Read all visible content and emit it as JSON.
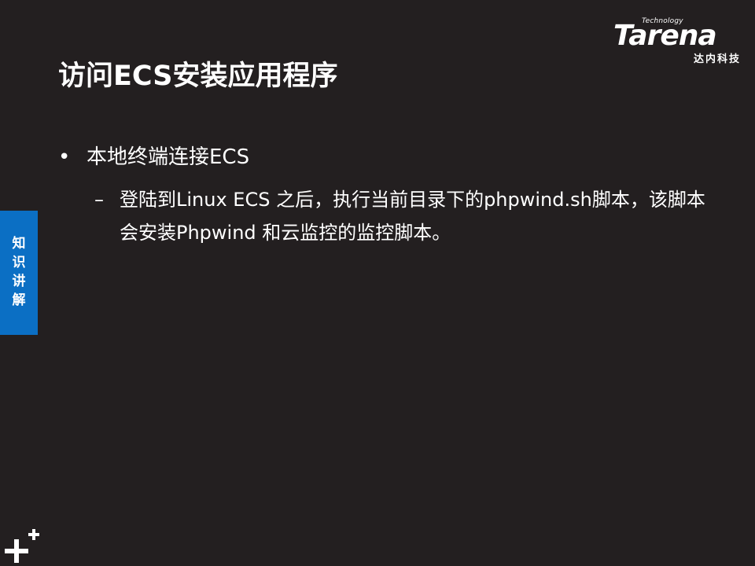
{
  "slide": {
    "title": "访问ECS安装应用程序",
    "logo": {
      "technology": "Technology",
      "brand": "Tarena",
      "cn": "达内科技"
    },
    "side_tab": "知识讲解",
    "bullets": [
      {
        "marker": "•",
        "text": "本地终端连接ECS",
        "children": [
          {
            "marker": "–",
            "text": "登陆到Linux ECS 之后，执行当前目录下的phpwind.sh脚本，该脚本会安装Phpwind 和云监控的监控脚本。"
          }
        ]
      }
    ]
  },
  "colors": {
    "background": "#231f20",
    "text": "#ffffff",
    "accent": "#0b6fc4"
  },
  "icons": {
    "corner": "plus-plus-icon"
  }
}
